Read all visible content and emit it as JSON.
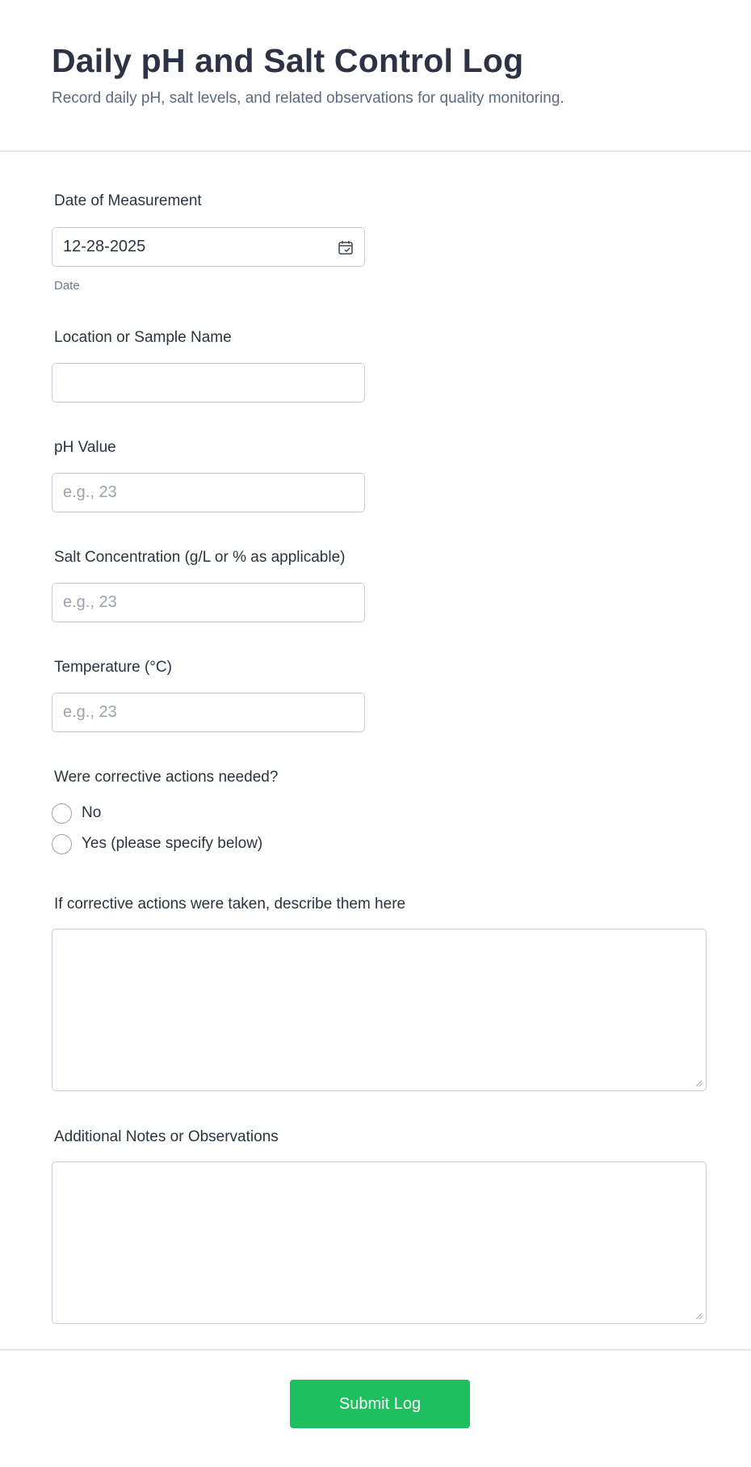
{
  "header": {
    "title": "Daily pH and Salt Control Log",
    "subtitle": "Record daily pH, salt levels, and related observations for quality monitoring."
  },
  "fields": {
    "date": {
      "label": "Date of Measurement",
      "value": "12-28-2025",
      "helper": "Date",
      "icon": "calendar-icon"
    },
    "location": {
      "label": "Location or Sample Name",
      "value": ""
    },
    "ph": {
      "label": "pH Value",
      "placeholder": "e.g., 23"
    },
    "salt": {
      "label": "Salt Concentration (g/L or % as applicable)",
      "placeholder": "e.g., 23"
    },
    "temperature": {
      "label": "Temperature (°C)",
      "placeholder": "e.g., 23"
    },
    "corrective": {
      "label": "Were corrective actions needed?",
      "options": [
        "No",
        "Yes (please specify below)"
      ]
    },
    "corrective_details": {
      "label": "If corrective actions were taken, describe them here"
    },
    "notes": {
      "label": "Additional Notes or Observations"
    }
  },
  "actions": {
    "submit_label": "Submit Log"
  },
  "colors": {
    "accent": "#1dbf5e",
    "title": "#2d3345",
    "subtitle": "#5a6b80",
    "border": "#c9ced6"
  }
}
